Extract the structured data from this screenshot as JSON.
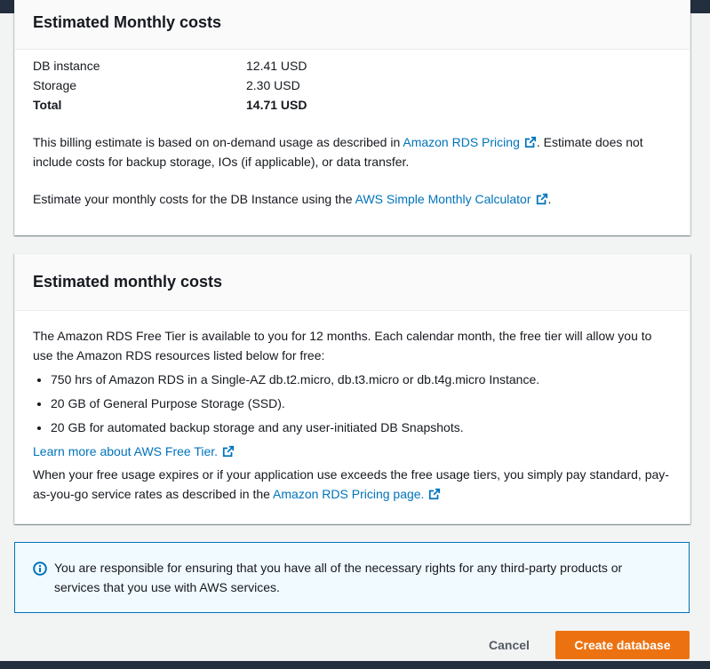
{
  "panel1": {
    "title": "Estimated Monthly costs",
    "rows": [
      {
        "label": "DB instance",
        "value": "12.41 USD"
      },
      {
        "label": "Storage",
        "value": "2.30 USD"
      },
      {
        "label": "Total",
        "value": "14.71 USD"
      }
    ],
    "billing_text_before": "This billing estimate is based on on-demand usage as described in ",
    "billing_link": "Amazon RDS Pricing",
    "billing_text_after": ". Estimate does not include costs for backup storage, IOs (if applicable), or data transfer.",
    "calc_text_before": "Estimate your monthly costs for the DB Instance using the ",
    "calc_link": "AWS Simple Monthly Calculator",
    "calc_text_after": "."
  },
  "panel2": {
    "title": "Estimated monthly costs",
    "intro": "The Amazon RDS Free Tier is available to you for 12 months. Each calendar month, the free tier will allow you to use the Amazon RDS resources listed below for free:",
    "items": [
      "750 hrs of Amazon RDS in a Single-AZ db.t2.micro, db.t3.micro or db.t4g.micro Instance.",
      "20 GB of General Purpose Storage (SSD).",
      "20 GB for automated backup storage and any user-initiated DB Snapshots."
    ],
    "learn_link": "Learn more about AWS Free Tier.",
    "expiry_text": "When your free usage expires or if your application use exceeds the free usage tiers, you simply pay standard, pay-as-you-go service rates as described in the ",
    "pricing_link": "Amazon RDS Pricing page."
  },
  "info": {
    "text": "You are responsible for ensuring that you have all of the necessary rights for any third-party products or services that you use with AWS services."
  },
  "actions": {
    "cancel": "Cancel",
    "create": "Create database"
  },
  "colors": {
    "link": "#0073bb",
    "primary": "#ec7211",
    "info_bg": "#f1faff",
    "nav": "#232f3e"
  }
}
